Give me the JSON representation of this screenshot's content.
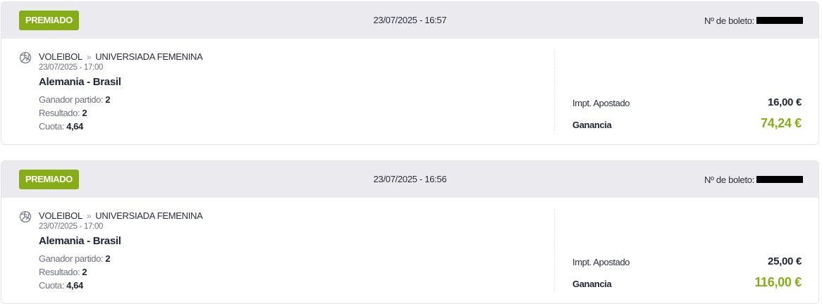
{
  "tickets": [
    {
      "status": "PREMIADO",
      "placed_at": "23/07/2025 - 16:57",
      "ticket_number_label": "Nº de boleto:",
      "sport": "VOLEIBOL",
      "competition": "UNIVERSIADA FEMENINA",
      "event_date": "23/07/2025 - 17:00",
      "match": "Alemania - Brasil",
      "market_label": "Ganador partido:",
      "market_value": "2",
      "result_label": "Resultado:",
      "result_value": "2",
      "odds_label": "Cuota:",
      "odds_value": "4,64",
      "stake_label": "Impt. Apostado",
      "stake_value": "16,00 €",
      "winnings_label": "Ganancia",
      "winnings_value": "74,24 €"
    },
    {
      "status": "PREMIADO",
      "placed_at": "23/07/2025 - 16:56",
      "ticket_number_label": "Nº de boleto:",
      "sport": "VOLEIBOL",
      "competition": "UNIVERSIADA FEMENINA",
      "event_date": "23/07/2025 - 17:00",
      "match": "Alemania - Brasil",
      "market_label": "Ganador partido:",
      "market_value": "2",
      "result_label": "Resultado:",
      "result_value": "2",
      "odds_label": "Cuota:",
      "odds_value": "4,64",
      "stake_label": "Impt. Apostado",
      "stake_value": "25,00 €",
      "winnings_label": "Ganancia",
      "winnings_value": "116,00 €"
    }
  ],
  "icons": {
    "sport": "volleyball-icon",
    "breadcrumb_separator": "chevron-double-right-icon"
  },
  "colors": {
    "accent_green": "#86ad16",
    "header_bg": "#ebebef",
    "text_dark": "#1f2333",
    "text_muted": "#6e7180",
    "redaction": "#000000"
  }
}
